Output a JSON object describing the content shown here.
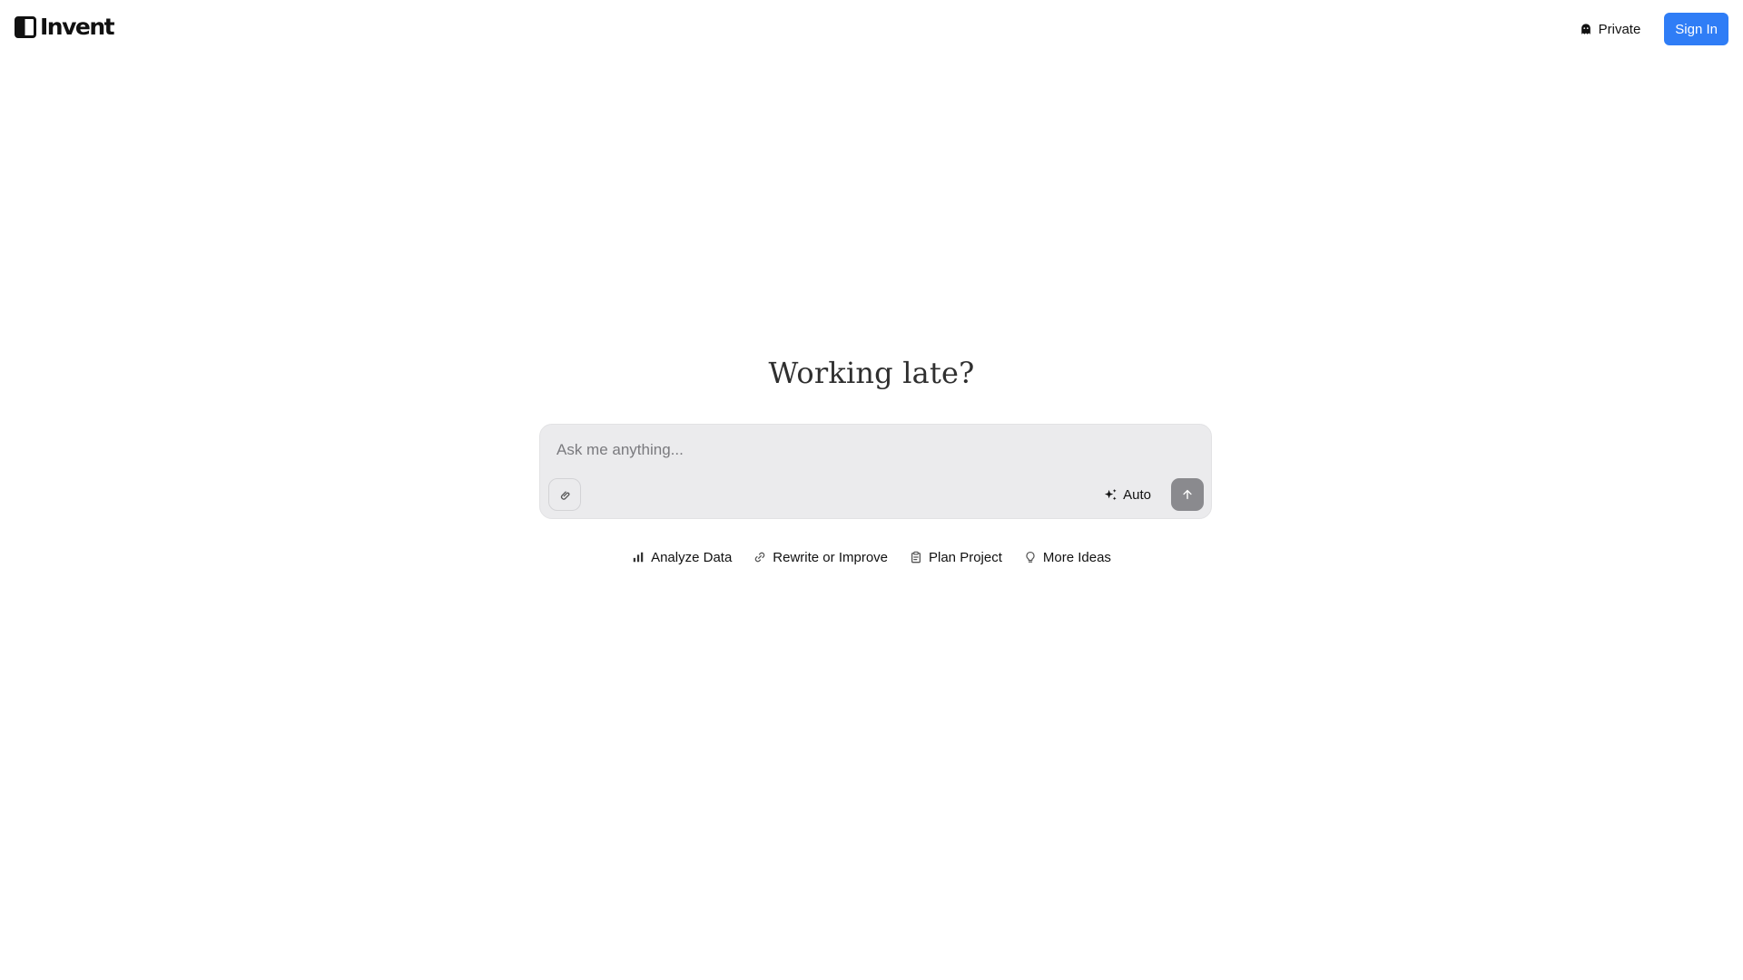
{
  "header": {
    "logo_text": "Invent",
    "private_label": "Private",
    "signin_label": "Sign In"
  },
  "hero": {
    "title": "Working late?"
  },
  "composer": {
    "placeholder": "Ask me anything...",
    "value": "",
    "model_label": "Auto"
  },
  "suggestions": [
    {
      "label": "Analyze Data",
      "icon": "bar-chart-icon"
    },
    {
      "label": "Rewrite or Improve",
      "icon": "link-icon"
    },
    {
      "label": "Plan Project",
      "icon": "clipboard-icon"
    },
    {
      "label": "More Ideas",
      "icon": "lightbulb-icon"
    }
  ],
  "colors": {
    "accent": "#2f7df6",
    "composer_bg": "#ebebed",
    "send_button": "#8a8a8e"
  }
}
